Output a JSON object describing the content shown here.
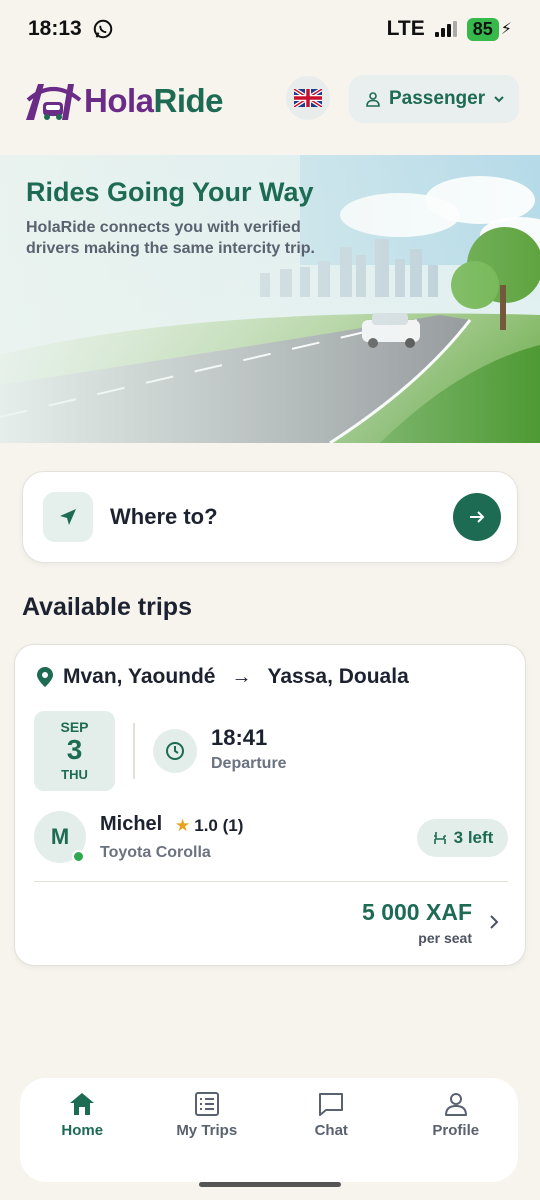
{
  "status_bar": {
    "time": "18:13",
    "network": "LTE",
    "battery": "85"
  },
  "header": {
    "logo_part1": "Hola",
    "logo_part2": "Ride",
    "language_flag": "uk-flag-icon",
    "role_label": "Passenger"
  },
  "hero": {
    "title": "Rides Going Your Way",
    "subtitle": "HolaRide connects you with verified drivers making the same intercity trip."
  },
  "search": {
    "placeholder": "Where to?"
  },
  "section": {
    "title": "Available trips"
  },
  "trip": {
    "from": "Mvan, Yaoundé",
    "arrow": "→",
    "to": "Yassa, Douala",
    "month": "SEP",
    "day": "3",
    "weekday": "THU",
    "time": "18:41",
    "time_label": "Departure",
    "driver_initial": "M",
    "driver_name": "Michel",
    "rating": "1.0 (1)",
    "car": "Toyota Corolla",
    "seats": "3 left",
    "price": "5 000 XAF",
    "price_unit": "per seat"
  },
  "nav": {
    "items": [
      {
        "label": "Home",
        "icon": "home-icon",
        "active": true
      },
      {
        "label": "My Trips",
        "icon": "list-icon",
        "active": false
      },
      {
        "label": "Chat",
        "icon": "chat-icon",
        "active": false
      },
      {
        "label": "Profile",
        "icon": "profile-icon",
        "active": false
      }
    ]
  },
  "colors": {
    "brand_green": "#1e6b53",
    "brand_purple": "#6a2c86",
    "background": "#f7f4ee",
    "battery_green": "#36b84a"
  }
}
